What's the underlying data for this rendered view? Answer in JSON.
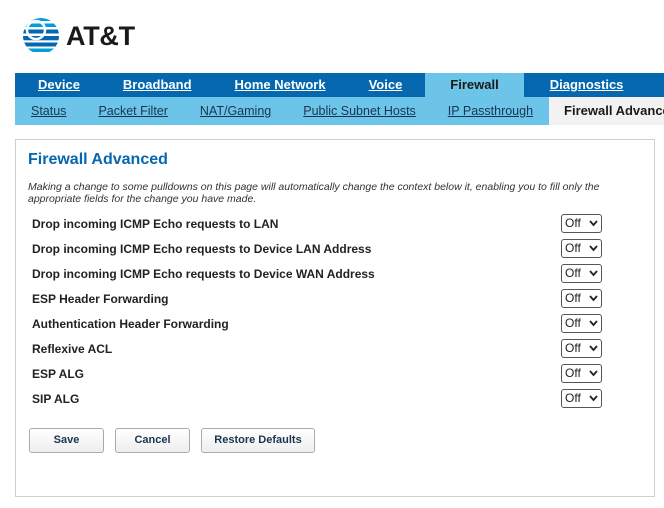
{
  "brand": {
    "name": "AT&T",
    "globe_colors": [
      "#0568ae",
      "#009fdb"
    ]
  },
  "main_nav": {
    "tabs": [
      {
        "label": "Device"
      },
      {
        "label": "Broadband"
      },
      {
        "label": "Home Network"
      },
      {
        "label": "Voice"
      },
      {
        "label": "Firewall",
        "active": true
      },
      {
        "label": "Diagnostics"
      }
    ]
  },
  "sub_nav": {
    "tabs": [
      {
        "label": "Status"
      },
      {
        "label": "Packet Filter"
      },
      {
        "label": "NAT/Gaming"
      },
      {
        "label": "Public Subnet Hosts"
      },
      {
        "label": "IP Passthrough"
      },
      {
        "label": "Firewall Advanced",
        "active": true
      }
    ]
  },
  "panel": {
    "title": "Firewall Advanced",
    "note": "Making a change to some pulldowns on this page will automatically change the context below it, enabling you to fill only the appropriate fields for the change you have made.",
    "settings": [
      {
        "label": "Drop incoming ICMP Echo requests to LAN",
        "value": "Off"
      },
      {
        "label": "Drop incoming ICMP Echo requests to Device LAN Address",
        "value": "Off"
      },
      {
        "label": "Drop incoming ICMP Echo requests to Device WAN Address",
        "value": "Off"
      },
      {
        "label": "ESP Header Forwarding",
        "value": "Off"
      },
      {
        "label": "Authentication Header Forwarding",
        "value": "Off"
      },
      {
        "label": "Reflexive ACL",
        "value": "Off"
      },
      {
        "label": "ESP ALG",
        "value": "Off"
      },
      {
        "label": "SIP ALG",
        "value": "Off"
      }
    ]
  },
  "buttons": {
    "save": "Save",
    "cancel": "Cancel",
    "restore": "Restore Defaults"
  },
  "colors": {
    "nav_primary": "#0568ae",
    "nav_secondary": "#6cc4e8",
    "title": "#0568ae"
  }
}
